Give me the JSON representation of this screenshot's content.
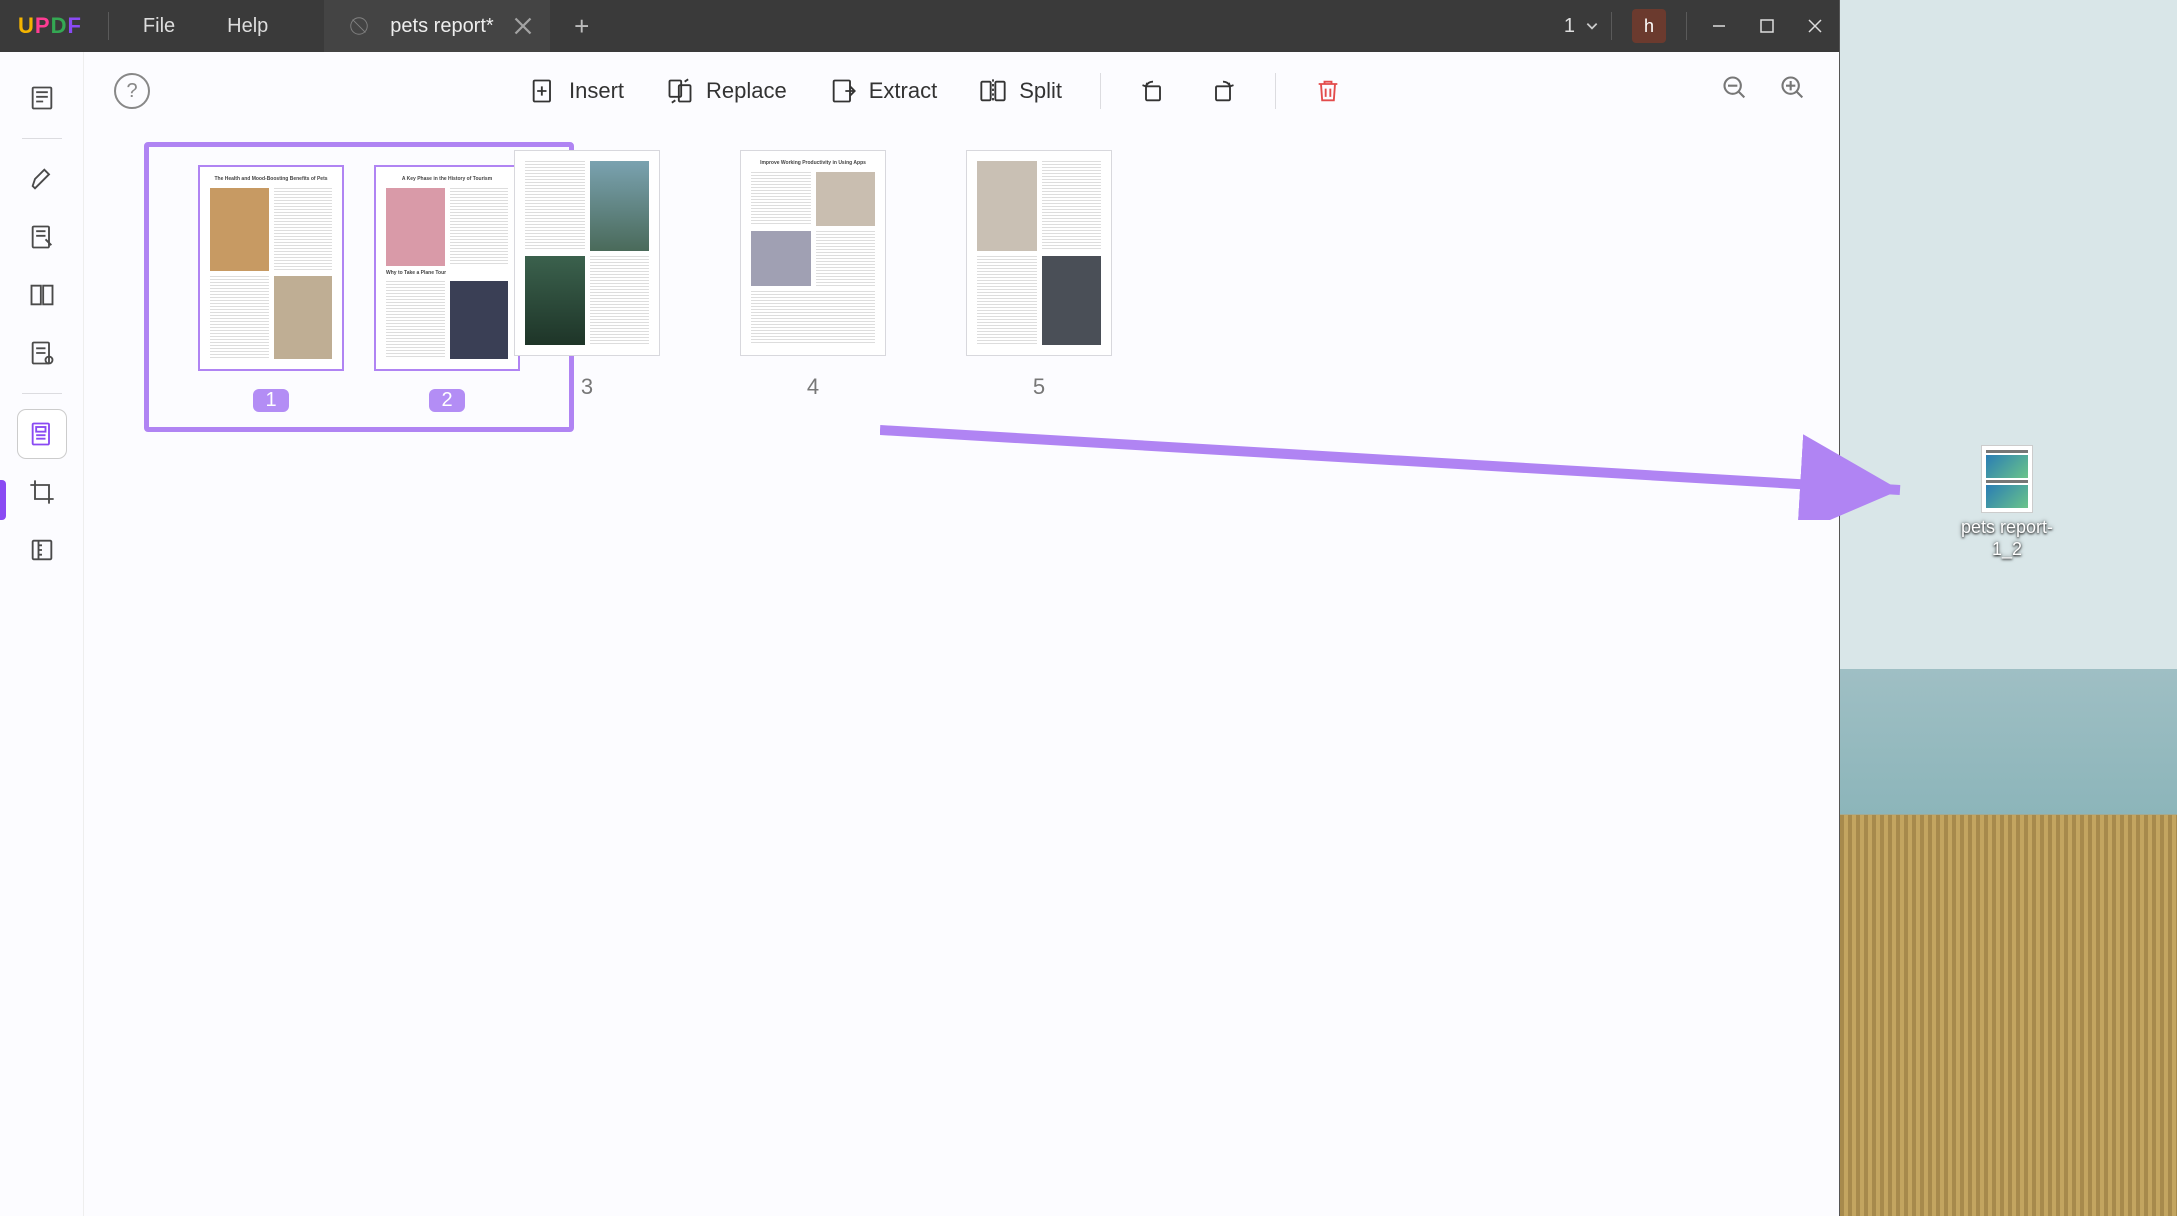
{
  "brand": {
    "u": "U",
    "p": "P",
    "d": "D",
    "f": "F"
  },
  "menu": {
    "file": "File",
    "help": "Help"
  },
  "tab": {
    "title": "pets report*"
  },
  "title_count": "1",
  "user_initial": "h",
  "toolbar": {
    "insert": "Insert",
    "replace": "Replace",
    "extract": "Extract",
    "split": "Split"
  },
  "pages": [
    {
      "num": "1",
      "title": "The Health and Mood-Boosting Benefits of Pets",
      "sel": true
    },
    {
      "num": "2",
      "title": "A Key Phase in the History of Tourism",
      "sel": true,
      "sub": "Why to Take a Plane Tour"
    },
    {
      "num": "3",
      "title": ""
    },
    {
      "num": "4",
      "title": "Improve Working Productivity in Using Apps"
    },
    {
      "num": "5",
      "title": ""
    }
  ],
  "desktop_file": "pets report-1_2"
}
